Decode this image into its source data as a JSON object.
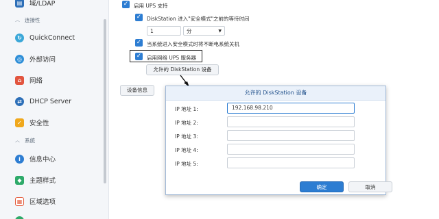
{
  "sidebar": {
    "top_item": {
      "label": "域/LDAP",
      "icon": "directory-icon"
    },
    "section_connectivity": "连接性",
    "connectivity_items": [
      {
        "label": "QuickConnect",
        "icon": "quickconnect-icon",
        "color": "#3aa7d8"
      },
      {
        "label": "外部访问",
        "icon": "globe-icon",
        "color": "#2f8fd8"
      },
      {
        "label": "网络",
        "icon": "network-house-icon",
        "color": "#e2553f"
      },
      {
        "label": "DHCP Server",
        "icon": "dhcp-icon",
        "color": "#2d6fb8"
      },
      {
        "label": "安全性",
        "icon": "shield-icon",
        "color": "#f0a81c"
      }
    ],
    "section_system": "系统",
    "system_items": [
      {
        "label": "信息中心",
        "icon": "info-icon",
        "color": "#2d7dd2"
      },
      {
        "label": "主题样式",
        "icon": "palette-icon",
        "color": "#2eaa6a"
      },
      {
        "label": "区域选项",
        "icon": "calendar-icon",
        "color": "#e45a3b"
      }
    ]
  },
  "ups": {
    "enable_ups": "启用 UPS 支持",
    "wait_time_label": "DiskStation 进入\"安全模式\"之前的等待时间",
    "wait_value": "1",
    "wait_unit": "分",
    "shutdown_label": "当系统进入安全模式时将不断电系统关机",
    "network_server_label": "启用网络 UPS 服务器",
    "allowed_devices_button": "允许的 DiskStation 设备",
    "device_info_button": "设备信息"
  },
  "dialog": {
    "title": "允许的 DiskStation 设备",
    "fields": [
      {
        "label": "IP 地址 1:",
        "value": "192.168.98.210"
      },
      {
        "label": "IP 地址 2:",
        "value": ""
      },
      {
        "label": "IP 地址 3:",
        "value": ""
      },
      {
        "label": "IP 地址 4:",
        "value": ""
      },
      {
        "label": "IP 地址 5:",
        "value": ""
      }
    ],
    "ok": "确定",
    "cancel": "取消"
  },
  "colors": {
    "accent": "#2d7dd2",
    "dialog_title": "#1f4f8a"
  }
}
